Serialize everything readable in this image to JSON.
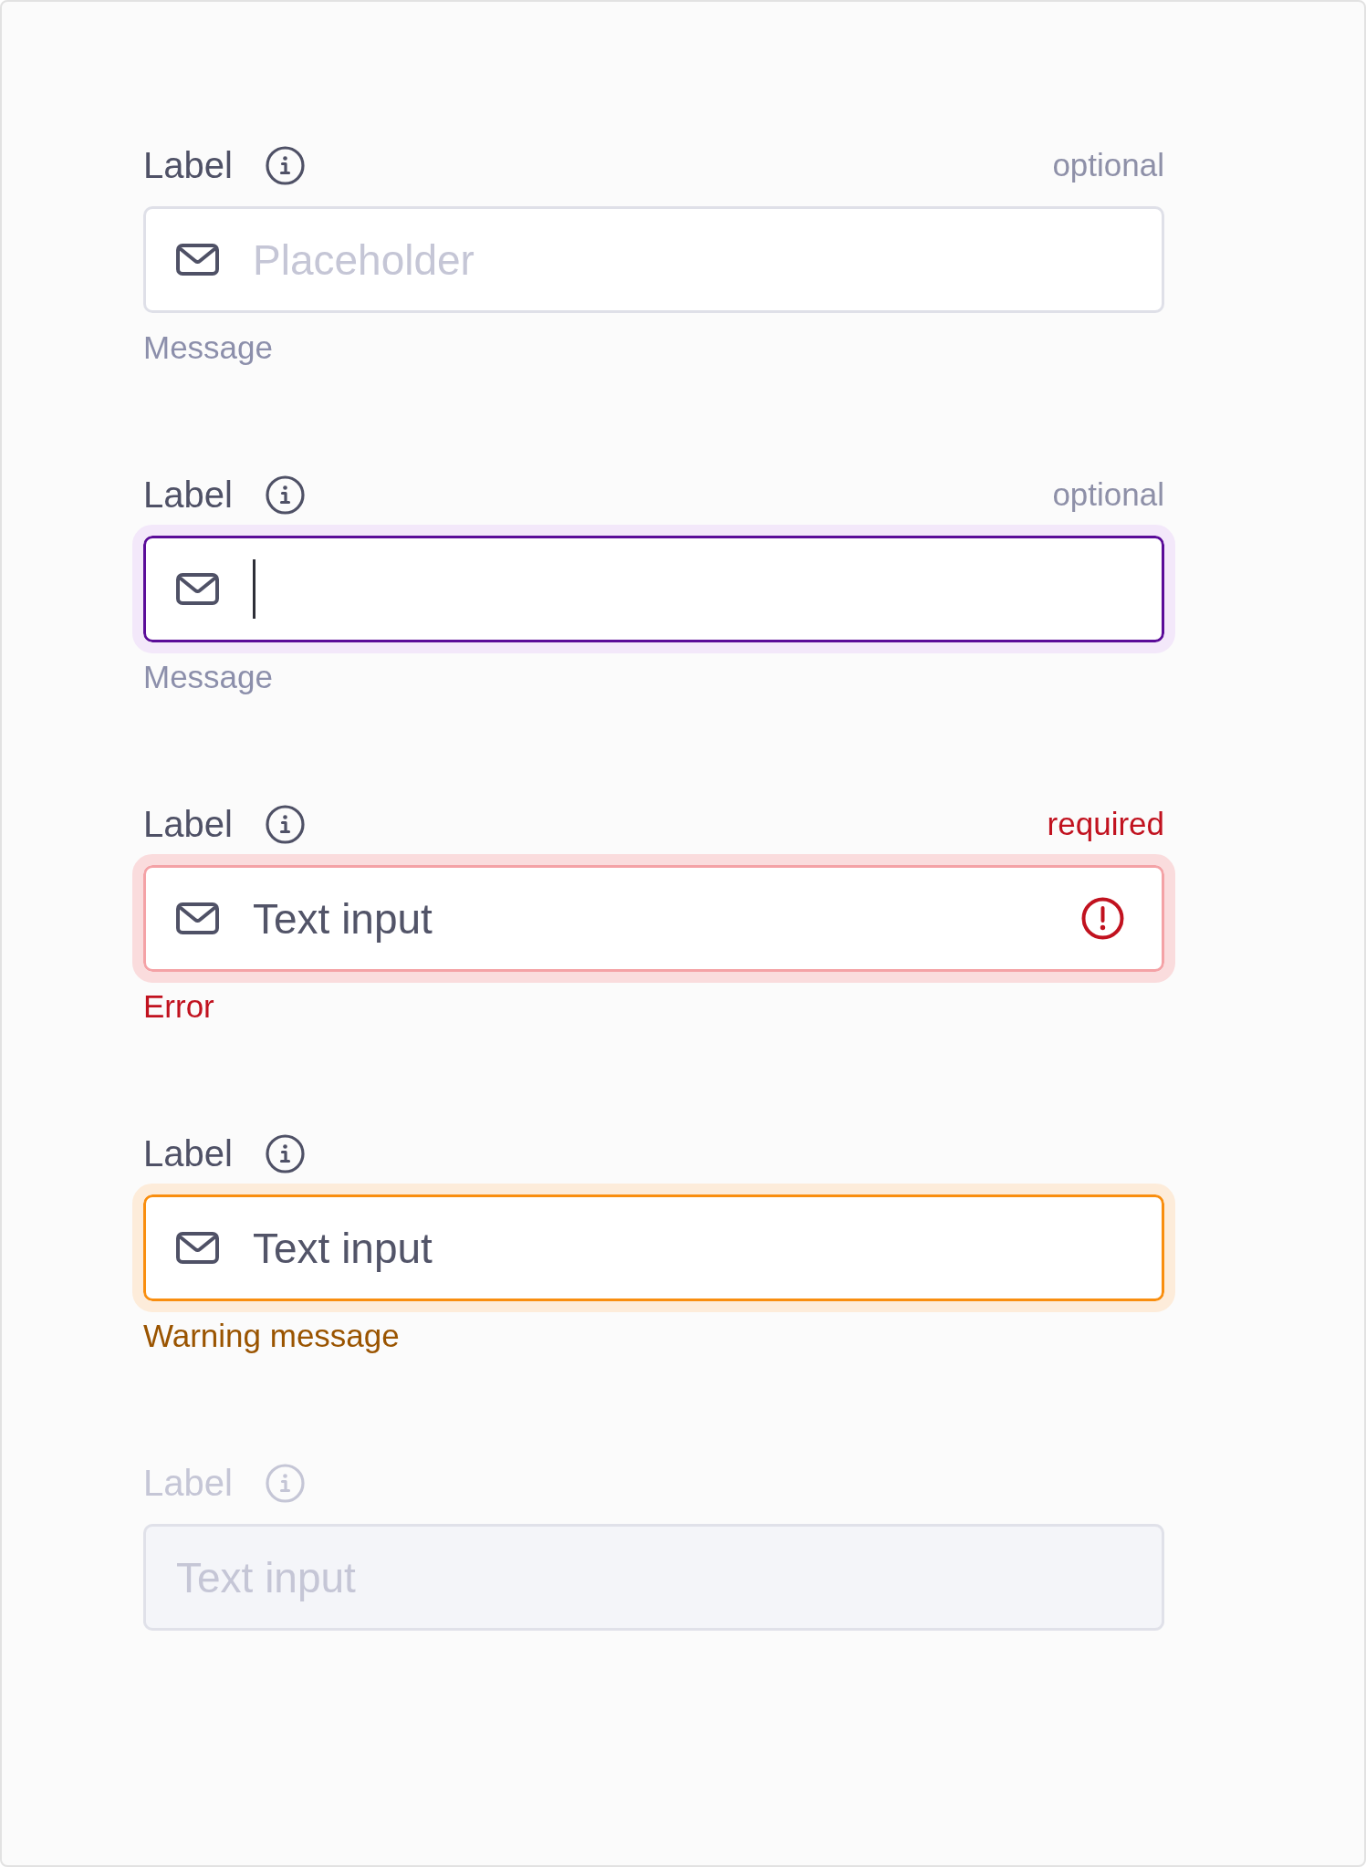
{
  "fields": [
    {
      "kind": "default",
      "label": "Label",
      "tag": "optional",
      "placeholder": "Placeholder",
      "message": "Message"
    },
    {
      "kind": "focus",
      "label": "Label",
      "tag": "optional",
      "message": "Message"
    },
    {
      "kind": "error",
      "label": "Label",
      "tag": "required",
      "value": "Text input",
      "message": "Error"
    },
    {
      "kind": "warning",
      "label": "Label",
      "value": "Text input",
      "message": "Warning message"
    },
    {
      "kind": "disabled",
      "label": "Label",
      "value": "Text input"
    }
  ]
}
